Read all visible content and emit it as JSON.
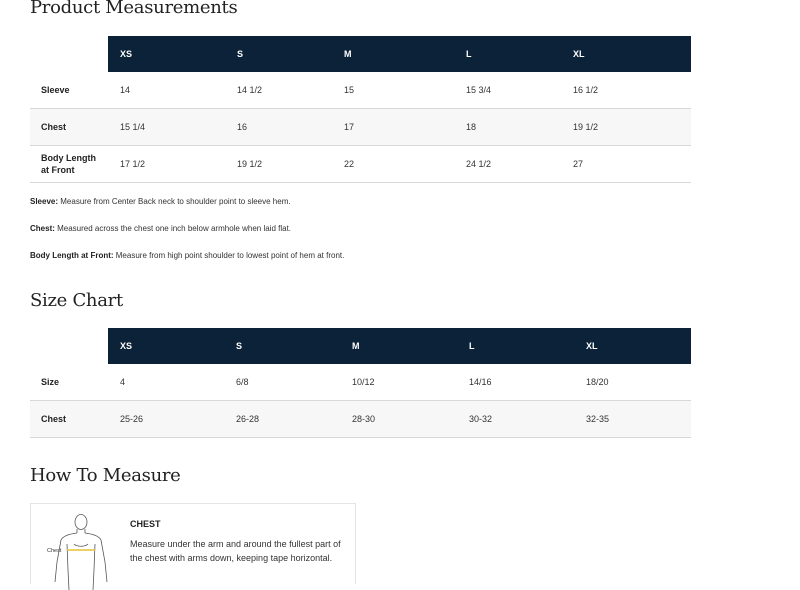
{
  "sections": {
    "measurements_title": "Product Measurements",
    "size_chart_title": "Size Chart",
    "how_to_title": "How To Measure"
  },
  "measurements": {
    "columns": [
      "XS",
      "S",
      "M",
      "L",
      "XL"
    ],
    "rows": [
      {
        "label": "Sleeve",
        "values": [
          "14",
          "14 1/2",
          "15",
          "15 3/4",
          "16 1/2"
        ]
      },
      {
        "label": "Chest",
        "values": [
          "15 1/4",
          "16",
          "17",
          "18",
          "19 1/2"
        ]
      },
      {
        "label_line1": "Body Length",
        "label_line2": "at Front",
        "values": [
          "17 1/2",
          "19 1/2",
          "22",
          "24 1/2",
          "27"
        ]
      }
    ]
  },
  "notes": {
    "sleeve_label": "Sleeve:",
    "sleeve_text": " Measure from Center Back neck to shoulder point to sleeve hem.",
    "chest_label": "Chest:",
    "chest_text": " Measured across the chest one inch below armhole when laid flat.",
    "body_label": "Body Length at Front:",
    "body_text": " Measure from high point shoulder to lowest point of hem at front."
  },
  "size_chart": {
    "columns": [
      "XS",
      "S",
      "M",
      "L",
      "XL"
    ],
    "rows": [
      {
        "label": "Size",
        "values": [
          "4",
          "6/8",
          "10/12",
          "14/16",
          "18/20"
        ]
      },
      {
        "label": "Chest",
        "values": [
          "25-26",
          "26-28",
          "28-30",
          "30-32",
          "32-35"
        ]
      }
    ]
  },
  "how_to": {
    "figure_label": "Chest",
    "heading": "CHEST",
    "text": "Measure under the arm and around the fullest part of the chest with arms down, keeping tape horizontal."
  },
  "colors": {
    "header_bg": "#0c2239",
    "tape_line": "#e8c233"
  }
}
